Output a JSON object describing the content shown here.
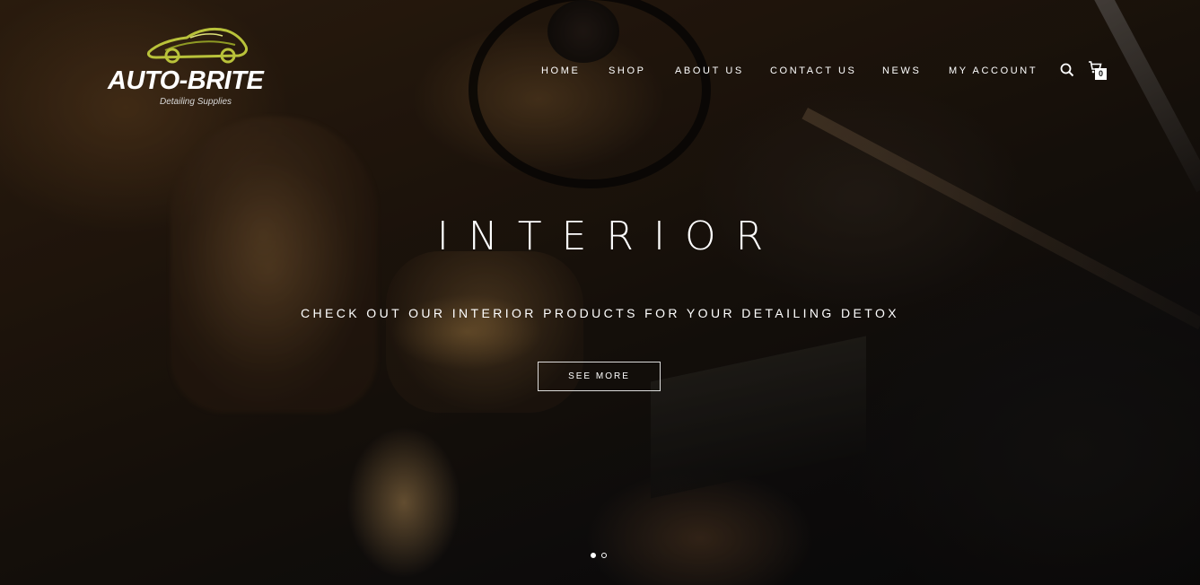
{
  "brand": {
    "name": "AUTO-BRITE",
    "tagline": "Detailing Supplies",
    "accent_color": "#b9c23a"
  },
  "nav": {
    "items": [
      {
        "label": "HOME"
      },
      {
        "label": "SHOP"
      },
      {
        "label": "ABOUT US"
      },
      {
        "label": "CONTACT US"
      },
      {
        "label": "NEWS"
      },
      {
        "label": "MY ACCOUNT"
      }
    ],
    "search_icon": "search-icon",
    "cart_icon": "cart-icon",
    "cart_count": "0"
  },
  "hero": {
    "title": "INTERIOR",
    "subtitle": "CHECK OUT OUR INTERIOR PRODUCTS FOR YOUR DETAILING DETOX",
    "button_label": "SEE MORE",
    "slides": [
      {
        "active": true
      },
      {
        "active": false
      }
    ]
  }
}
